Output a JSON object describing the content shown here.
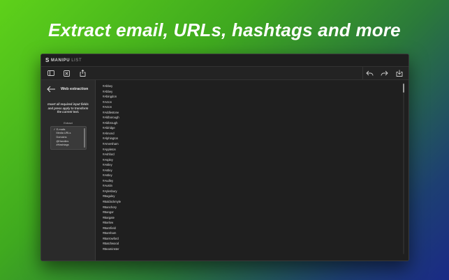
{
  "headline": "Extract email, URLs, hashtags and more",
  "app": {
    "logo_mark": "S",
    "logo_bold": "MANIPU",
    "logo_thin": "LIST"
  },
  "sidebar": {
    "title": "Web extraction",
    "description": "Insert all required input fields and press apply to transform the current text.",
    "extract_label": "Extract",
    "options": [
      {
        "label": "E-mails",
        "checked": true
      },
      {
        "label": "Media URLs",
        "checked": false
      },
      {
        "label": "Domains",
        "checked": false
      },
      {
        "label": "@Handles",
        "checked": false
      },
      {
        "label": "#Hashtags",
        "checked": false
      }
    ]
  },
  "items": [
    "#Abbey",
    "#Abbey",
    "#Abingdon",
    "#Acton",
    "#Acton",
    "#Addlestone",
    "#Aldborough",
    "#Aldbrough",
    "#Aldridge",
    "#Almond",
    "#Alphington",
    "#Amersham",
    "#Appleton",
    "#Ashford",
    "#Aspley",
    "#Astley",
    "#Astley",
    "#Astley",
    "#Audley",
    "#Austin",
    "#Aylesbury",
    "#Baguley",
    "#Baldockmyle",
    "#Banchory",
    "#Bangor",
    "#Bargate",
    "#Barlow",
    "#Barnfield",
    "#Barnham",
    "#Barrowford",
    "#Batchwood",
    "#Beaminster"
  ],
  "colors": {
    "window_bg": "#222222",
    "sidebar_bg": "#2a2a2a",
    "content_bg": "#1f1f1f",
    "text": "#dcdcdc"
  }
}
